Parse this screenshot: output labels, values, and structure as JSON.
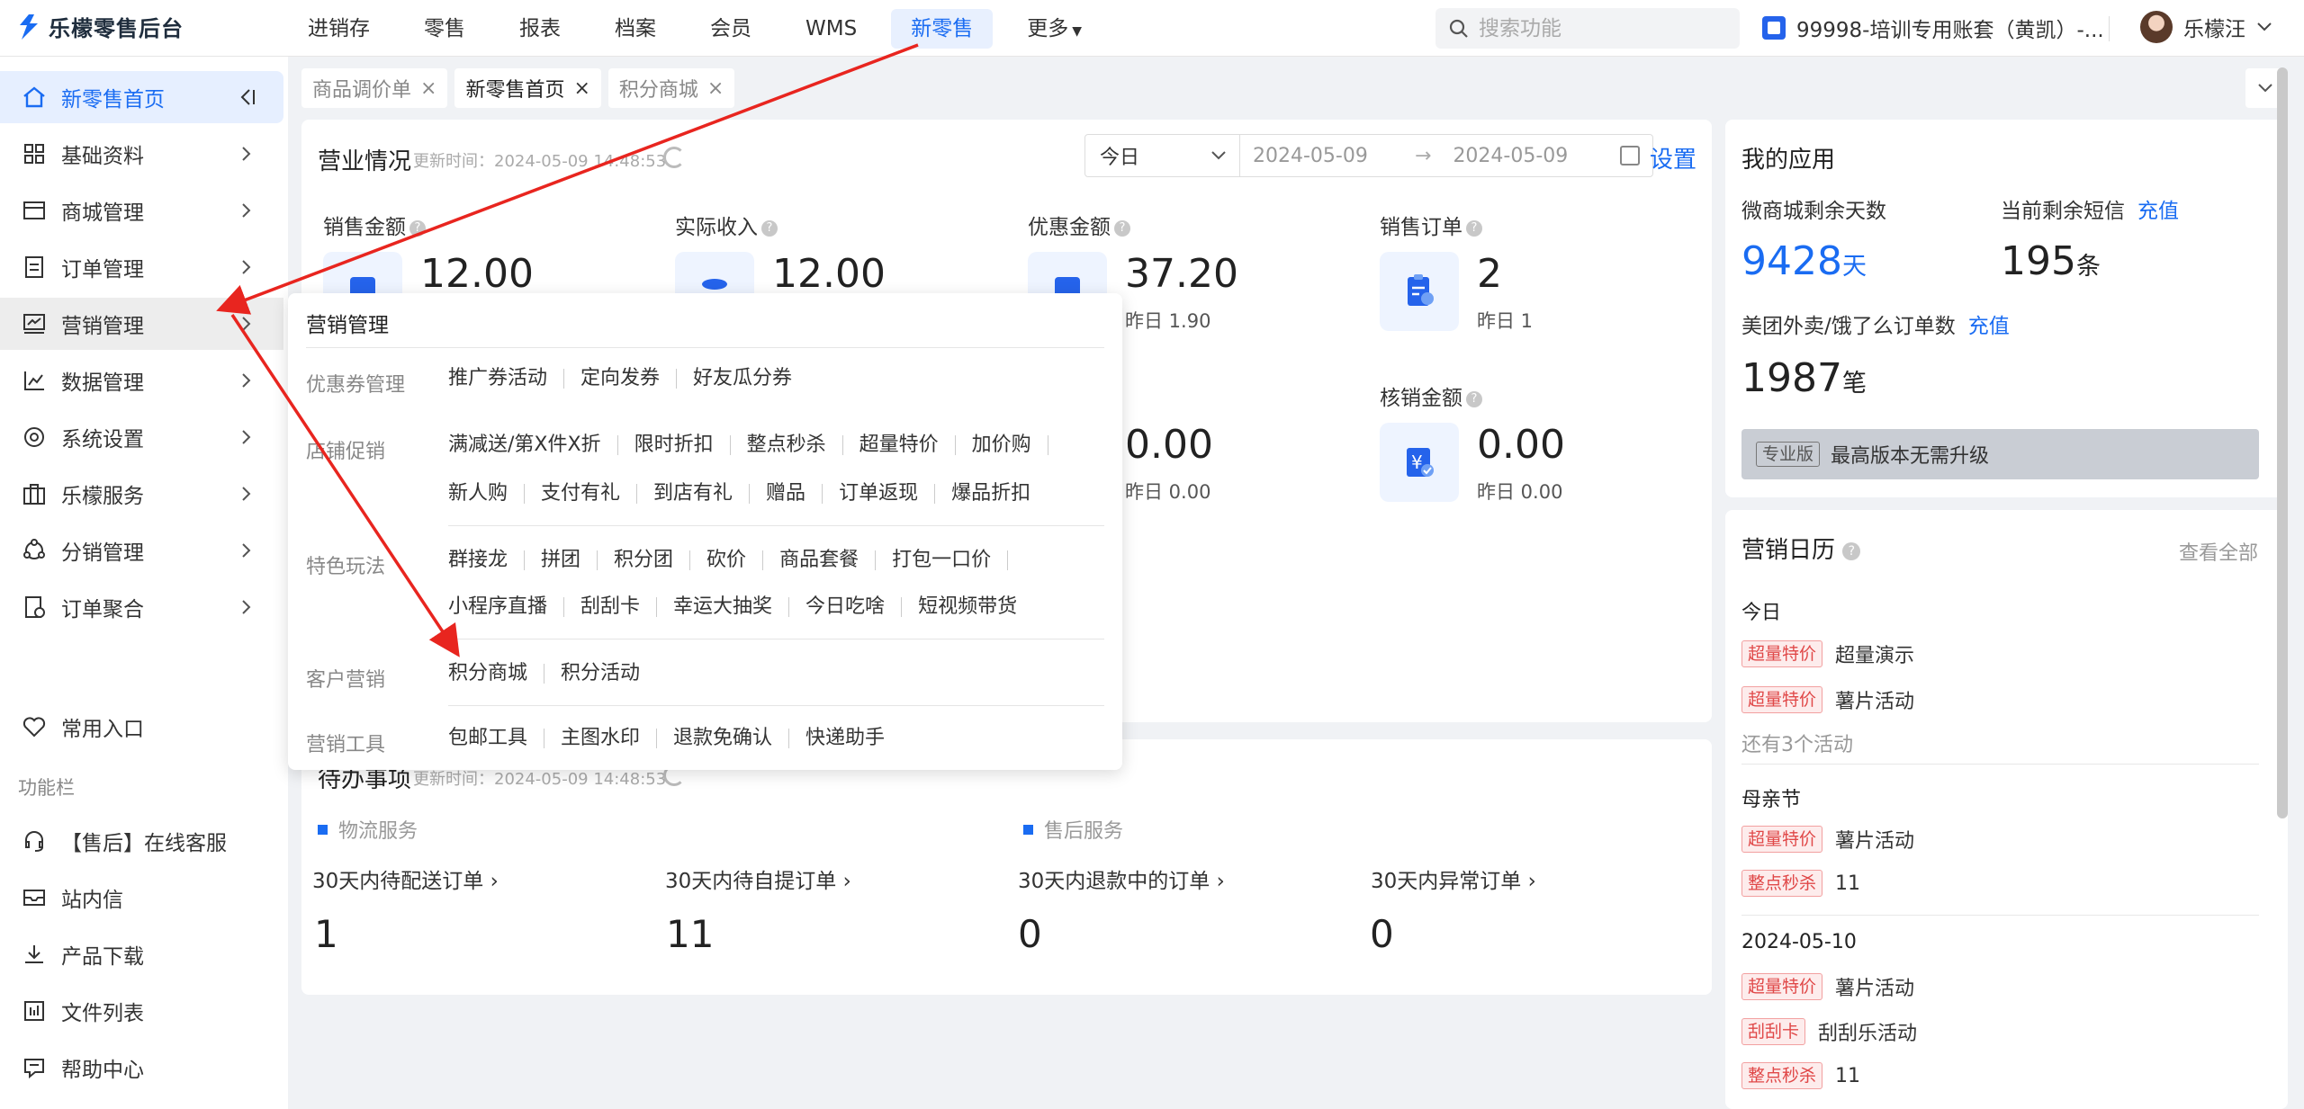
{
  "app": {
    "logo_text": "乐檬零售后台",
    "brand_color": "#1a6cf2"
  },
  "nav": {
    "items": [
      {
        "label": "进销存"
      },
      {
        "label": "零售"
      },
      {
        "label": "报表"
      },
      {
        "label": "档案"
      },
      {
        "label": "会员"
      },
      {
        "label": "WMS"
      },
      {
        "label": "新零售"
      },
      {
        "label": "更多"
      }
    ],
    "active": "新零售"
  },
  "search": {
    "placeholder": "搜索功能"
  },
  "account": {
    "name": "99998-培训专用账套（黄凯）-..."
  },
  "user": {
    "name": "乐檬汪"
  },
  "sidebar": {
    "items": [
      {
        "label": "新零售首页",
        "icon": "home-icon"
      },
      {
        "label": "基础资料",
        "icon": "grid-icon"
      },
      {
        "label": "商城管理",
        "icon": "store-icon"
      },
      {
        "label": "订单管理",
        "icon": "order-icon"
      },
      {
        "label": "营销管理",
        "icon": "marketing-icon"
      },
      {
        "label": "数据管理",
        "icon": "chart-icon"
      },
      {
        "label": "系统设置",
        "icon": "gear-icon"
      },
      {
        "label": "乐檬服务",
        "icon": "service-icon"
      },
      {
        "label": "分销管理",
        "icon": "distribution-icon"
      },
      {
        "label": "订单聚合",
        "icon": "aggregate-icon"
      }
    ],
    "favorites": "常用入口",
    "section_label": "功能栏",
    "tools": [
      {
        "label": "【售后】在线客服",
        "icon": "headset-icon"
      },
      {
        "label": "站内信",
        "icon": "mail-icon"
      },
      {
        "label": "产品下载",
        "icon": "download-icon"
      },
      {
        "label": "文件列表",
        "icon": "file-list-icon"
      },
      {
        "label": "帮助中心",
        "icon": "help-icon"
      }
    ]
  },
  "tabs": [
    {
      "label": "商品调价单",
      "close": "×"
    },
    {
      "label": "新零售首页",
      "close": "×"
    },
    {
      "label": "积分商城",
      "close": "×"
    }
  ],
  "business": {
    "title": "营业情况",
    "updated": "更新时间：2024-05-09 14:48:53",
    "period": "今日",
    "date_from": "2024-05-09",
    "date_to": "2024-05-09",
    "date_sep": "→",
    "settings": "设置",
    "metrics": [
      {
        "label": "销售金额",
        "value": "12.00"
      },
      {
        "label": "实际收入",
        "value": "12.00"
      },
      {
        "label": "优惠金额",
        "value": "37.20",
        "yesterday": "昨日 1.90"
      },
      {
        "label": "销售订单",
        "value": "2",
        "yesterday": "昨日 1"
      },
      {
        "value": "0.00",
        "yesterday": "昨日 0.00"
      },
      {
        "label": "核销金额",
        "value": "0.00",
        "yesterday": "昨日 0.00"
      }
    ]
  },
  "popup": {
    "title": "营销管理",
    "groups": [
      {
        "category": "优惠券管理",
        "links": [
          "推广券活动",
          "定向发券",
          "好友瓜分券"
        ]
      },
      {
        "category": "店铺促销",
        "links": [
          "满减送/第X件X折",
          "限时折扣",
          "整点秒杀",
          "超量特价",
          "加价购"
        ],
        "links2": [
          "新人购",
          "支付有礼",
          "到店有礼",
          "赠品",
          "订单返现",
          "爆品折扣"
        ]
      },
      {
        "category": "特色玩法",
        "links": [
          "群接龙",
          "拼团",
          "积分团",
          "砍价",
          "商品套餐",
          "打包一口价"
        ],
        "links2": [
          "小程序直播",
          "刮刮卡",
          "幸运大抽奖",
          "今日吃啥",
          "短视频带货"
        ]
      },
      {
        "category": "客户营销",
        "links": [
          "积分商城",
          "积分活动"
        ]
      },
      {
        "category": "营销工具",
        "links": [
          "包邮工具",
          "主图水印",
          "退款免确认",
          "快递助手"
        ]
      }
    ]
  },
  "todo": {
    "title": "待办事项",
    "updated": "更新时间：2024-05-09 14:48:53",
    "logistics": "物流服务",
    "aftersales": "售后服务",
    "items": [
      {
        "label": "30天内待配送订单",
        "value": "1"
      },
      {
        "label": "30天内待自提订单",
        "value": "11"
      },
      {
        "label": "30天内退款中的订单",
        "value": "0"
      },
      {
        "label": "30天内异常订单",
        "value": "0"
      }
    ]
  },
  "apps": {
    "title": "我的应用",
    "mall_days_label": "微商城剩余天数",
    "mall_days": "9428",
    "mall_days_unit": "天",
    "sms_label": "当前剩余短信",
    "sms_recharge": "充值",
    "sms": "195",
    "sms_unit": "条",
    "waimai_label": "美团外卖/饿了么订单数",
    "waimai_recharge": "充值",
    "waimai": "1987",
    "waimai_unit": "笔",
    "pro_badge": "专业版",
    "upgrade_text": "最高版本无需升级"
  },
  "calendar": {
    "title": "营销日历",
    "view_all": "查看全部",
    "days": [
      {
        "date": "今日",
        "events": [
          {
            "tag": "超量特价",
            "name": "超量演示"
          },
          {
            "tag": "超量特价",
            "name": "薯片活动"
          }
        ],
        "more": "还有3个活动"
      },
      {
        "date": "母亲节",
        "events": [
          {
            "tag": "超量特价",
            "name": "薯片活动"
          },
          {
            "tag": "整点秒杀",
            "name": "11"
          }
        ]
      },
      {
        "date": "2024-05-10",
        "events": [
          {
            "tag": "超量特价",
            "name": "薯片活动"
          },
          {
            "tag": "刮刮卡",
            "name": "刮刮乐活动"
          },
          {
            "tag": "整点秒杀",
            "name": "11"
          }
        ]
      }
    ]
  },
  "annotation_color": "#e8251f"
}
